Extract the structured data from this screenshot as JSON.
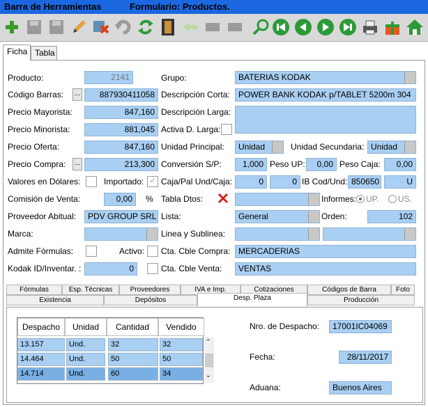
{
  "title": {
    "bar": "Barra de Herramientas",
    "form": "Formulario: Productos."
  },
  "toolbar": {
    "icons": [
      "add-icon",
      "save-icon",
      "save-disabled-icon",
      "edit-icon",
      "delete-icon",
      "undo-icon",
      "refresh-icon",
      "film-icon",
      "back-arrow-icon",
      "disabled-icon",
      "disabled-icon",
      "search-icon",
      "first-icon",
      "previous-icon",
      "next-icon",
      "last-icon",
      "print-icon",
      "gift-icon",
      "home-icon"
    ]
  },
  "tabs": {
    "ficha": "Ficha",
    "tabla": "Tabla"
  },
  "form": {
    "producto_label": "Producto:",
    "producto": "2141",
    "grupo_label": "Grupo:",
    "grupo": "BATERIAS KODAK",
    "codigo_barras_label": "Código Barras:",
    "codigo_barras": "887930411058",
    "desc_corta_label": "Descripción Corta:",
    "desc_corta": "POWER BANK KODAK p/TABLET 5200m 304",
    "precio_mayorista_label": "Precio Mayorista:",
    "precio_mayorista": "847,160",
    "desc_larga_label": "Descripción Larga:",
    "desc_larga": "",
    "precio_minorista_label": "Precio Minorista:",
    "precio_minorista": "881,045",
    "activa_d_larga_label": "Activa D. Larga:",
    "precio_oferta_label": "Precio Oferta:",
    "precio_oferta": "847,160",
    "unidad_principal_label": "Unidad Principal:",
    "unidad_principal": "Unidad",
    "unidad_secundaria_label": "Unidad Secundaria:",
    "unidad_secundaria": "Unidad",
    "precio_compra_label": "Precio Compra:",
    "precio_compra": "213,300",
    "conversion_label": "Conversión S/P:",
    "conversion": "1,000",
    "peso_up_label": "Peso UP:",
    "peso_up": "0,00",
    "peso_caja_label": "Peso Caja:",
    "peso_caja": "0,00",
    "valores_dolares_label": "Valores en Dólares:",
    "importado_label": "Importado:",
    "caja_pal_label": "Caja/Pal Und/Caja:",
    "caja_pal": "0",
    "und_caja": "0",
    "ib_cod_und_label": "IB Cod/Und:",
    "ib_cod": "850650",
    "ib_und": "U",
    "comision_label": "Comisión de Venta:",
    "comision": "0,00",
    "comision_unit": "%",
    "tabla_dtos_label": "Tabla Dtos:",
    "informes_label": "Informes:",
    "informes_up": "UP.",
    "informes_us": "US.",
    "proveedor_label": "Proveedor Abitual:",
    "proveedor": "PDV GROUP SRL",
    "lista_label": "Lista:",
    "lista": "General",
    "orden_label": "Orden:",
    "orden": "102",
    "marca_label": "Marca:",
    "linea_label": "Linea y Sublinea:",
    "admite_formulas_label": "Admite Fórmulas:",
    "activo_label": "Activo:",
    "cta_compra_label": "Cta. Cble Compra:",
    "cta_compra": "MERCADERIAS",
    "kodak_id_label": "Kodak ID/Inventar. :",
    "kodak_id": "0",
    "cta_venta_label": "Cta. Cble Venta:",
    "cta_venta": "VENTAS"
  },
  "bottom_tabs": {
    "row1": [
      "Fórmulas",
      "Esp. Técnicas",
      "Proveedores",
      "IVA e Imp.",
      "Cotizaciones",
      "Códigos de Barra",
      "Foto"
    ],
    "row2": [
      "Existencia",
      "Depósitos",
      "Desp. Plaza",
      "Producción"
    ]
  },
  "grid": {
    "columns": [
      "Despacho",
      "Unidad",
      "Cantidad",
      "Vendido"
    ],
    "rows": [
      [
        "13.157",
        "Und.",
        "32",
        "32"
      ],
      [
        "14.464",
        "Und.",
        "50",
        "50"
      ],
      [
        "14.714",
        "Und.",
        "60",
        "34"
      ]
    ]
  },
  "despacho": {
    "nro_label": "Nro. de Despacho:",
    "nro": "17001IC04069",
    "fecha_label": "Fecha:",
    "fecha": "28/11/2017",
    "aduana_label": "Aduana:",
    "aduana": "Buenos Aires"
  }
}
